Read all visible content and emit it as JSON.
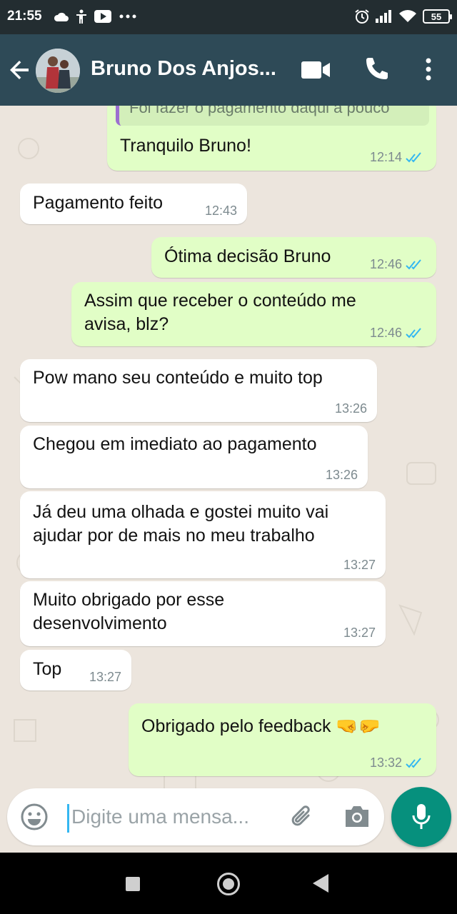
{
  "status_bar": {
    "time": "21:55",
    "battery": "55",
    "icons_left": [
      "cloud-icon",
      "accessibility-icon",
      "youtube-icon",
      "more-dots-icon"
    ],
    "icons_right": [
      "alarm-icon",
      "signal-icon",
      "wifi-icon",
      "battery-icon"
    ]
  },
  "header": {
    "contact_name": "Bruno Dos Anjos...",
    "icons": [
      "back-arrow-icon",
      "avatar",
      "video-call-icon",
      "phone-icon",
      "more-vert-icon"
    ],
    "bar_color": "#2e4a57"
  },
  "messages": [
    {
      "direction": "out",
      "quote": "Foi fazer o pagamento daqui a pouco",
      "text": "Tranquilo Bruno!",
      "time": "12:14",
      "read": true
    },
    {
      "direction": "in",
      "text": "Pagamento feito",
      "time": "12:43"
    },
    {
      "direction": "out",
      "text": "Ótima decisão Bruno",
      "time": "12:46",
      "read": true
    },
    {
      "direction": "out",
      "lines": [
        "Assim que receber o conteúdo me",
        "avisa, blz?"
      ],
      "time": "12:46",
      "read": true
    },
    {
      "direction": "in",
      "text": "Pow mano seu conteúdo e muito top",
      "time": "13:26"
    },
    {
      "direction": "in",
      "text": "Chegou em imediato ao pagamento",
      "time": "13:26"
    },
    {
      "direction": "in",
      "lines": [
        "Já deu uma olhada e gostei muito vai",
        "ajudar por de mais no meu trabalho"
      ],
      "time": "13:27"
    },
    {
      "direction": "in",
      "lines": [
        "Muito obrigado por esse",
        "desenvolvimento"
      ],
      "time": "13:27"
    },
    {
      "direction": "in",
      "text": "Top",
      "time": "13:27"
    },
    {
      "direction": "out",
      "text": "Obrigado pelo feedback 🤜🤛",
      "time": "13:32",
      "read": true
    }
  ],
  "composer": {
    "placeholder": "Digite uma mensa...",
    "icons": [
      "emoji-icon",
      "attach-icon",
      "camera-icon",
      "mic-icon"
    ]
  },
  "colors": {
    "incoming_bubble": "#ffffff",
    "outgoing_bubble": "#e1fec6",
    "read_ticks": "#34b7f1",
    "mic_button": "#06907d",
    "chat_background": "#ece5dd"
  }
}
